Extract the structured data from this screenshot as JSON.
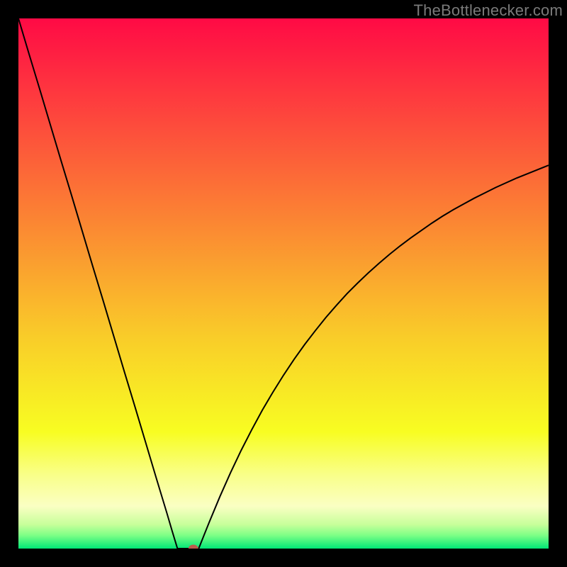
{
  "watermark": "TheBottlenecker.com",
  "chart_data": {
    "type": "line",
    "title": "",
    "xlabel": "",
    "ylabel": "",
    "xlim": [
      0,
      100
    ],
    "ylim": [
      0,
      100
    ],
    "x": [
      0,
      2,
      4,
      6,
      8,
      10,
      12,
      14,
      16,
      18,
      20,
      22,
      24,
      26,
      28,
      29,
      30,
      31,
      32,
      33,
      34,
      35,
      36,
      38,
      40,
      42,
      44,
      46,
      48,
      50,
      52,
      54,
      56,
      58,
      60,
      62,
      64,
      66,
      68,
      70,
      72,
      74,
      76,
      78,
      80,
      82,
      84,
      86,
      88,
      90,
      92,
      94,
      96,
      98,
      100
    ],
    "y": [
      100,
      93.3,
      86.7,
      80.0,
      73.3,
      66.7,
      60.0,
      53.3,
      46.7,
      40.0,
      33.3,
      26.7,
      20.0,
      13.3,
      6.7,
      3.3,
      0.0,
      0.0,
      0.0,
      0.0,
      0.0,
      2.5,
      5.0,
      9.8,
      14.3,
      18.5,
      22.4,
      26.1,
      29.5,
      32.7,
      35.7,
      38.5,
      41.1,
      43.6,
      45.9,
      48.1,
      50.1,
      52.0,
      53.8,
      55.5,
      57.1,
      58.6,
      60.0,
      61.4,
      62.7,
      63.9,
      65.0,
      66.1,
      67.1,
      68.1,
      69.0,
      69.9,
      70.7,
      71.5,
      72.3
    ],
    "marker": {
      "x": 33,
      "y": 0,
      "color": "#bd5b4c"
    },
    "background_gradient": {
      "type": "vertical",
      "stops": [
        {
          "pos": 0.0,
          "color": "#ff0a45"
        },
        {
          "pos": 0.2,
          "color": "#fd4b3c"
        },
        {
          "pos": 0.4,
          "color": "#fb8b32"
        },
        {
          "pos": 0.6,
          "color": "#f9cc29"
        },
        {
          "pos": 0.78,
          "color": "#f8fd22"
        },
        {
          "pos": 0.86,
          "color": "#f9ff88"
        },
        {
          "pos": 0.92,
          "color": "#faffc3"
        },
        {
          "pos": 0.955,
          "color": "#c7ff9a"
        },
        {
          "pos": 0.975,
          "color": "#7dff86"
        },
        {
          "pos": 1.0,
          "color": "#00e676"
        }
      ]
    },
    "line_color": "#000000",
    "line_width": 2
  }
}
